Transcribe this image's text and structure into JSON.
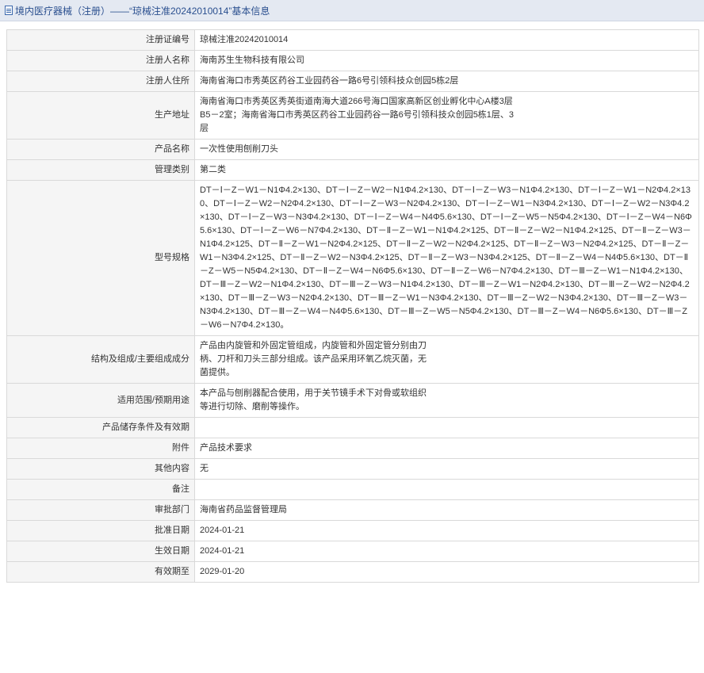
{
  "header": {
    "title": "境内医疗器械（注册）——“琼械注准20242010014”基本信息"
  },
  "rows": [
    {
      "label": "注册证编号",
      "value": "琼械注准20242010014"
    },
    {
      "label": "注册人名称",
      "value": "海南苏生生物科技有限公司"
    },
    {
      "label": "注册人住所",
      "value": "海南省海口市秀英区药谷工业园药谷一路6号引领科技众创园5栋2层"
    },
    {
      "label": "生产地址",
      "value": "海南省海口市秀英区秀英街道南海大道266号海口国家高新区创业孵化中心A楼3层B5－2室；海南省海口市秀英区药谷工业园药谷一路6号引领科技众创园5栋1层、3层"
    },
    {
      "label": "产品名称",
      "value": "一次性使用刨削刀头"
    },
    {
      "label": "管理类别",
      "value": "第二类"
    },
    {
      "label": "型号规格",
      "value": "DT－Ⅰ－Z－W1－N1Φ4.2×130、DT－Ⅰ－Z－W2－N1Φ4.2×130、DT－Ⅰ－Z－W3－N1Φ4.2×130、DT－Ⅰ－Z－W1－N2Φ4.2×130、DT－Ⅰ－Z－W2－N2Φ4.2×130、DT－Ⅰ－Z－W3－N2Φ4.2×130、DT－Ⅰ－Z－W1－N3Φ4.2×130、DT－Ⅰ－Z－W2－N3Φ4.2×130、DT－Ⅰ－Z－W3－N3Φ4.2×130、DT－Ⅰ－Z－W4－N4Φ5.6×130、DT－Ⅰ－Z－W5－N5Φ4.2×130、DT－Ⅰ－Z－W4－N6Φ5.6×130、DT－Ⅰ－Z－W6－N7Φ4.2×130、DT－Ⅱ－Z－W1－N1Φ4.2×125、DT－Ⅱ－Z－W2－N1Φ4.2×125、DT－Ⅱ－Z－W3－N1Φ4.2×125、DT－Ⅱ－Z－W1－N2Φ4.2×125、DT－Ⅱ－Z－W2－N2Φ4.2×125、DT－Ⅱ－Z－W3－N2Φ4.2×125、DT－Ⅱ－Z－W1－N3Φ4.2×125、DT－Ⅱ－Z－W2－N3Φ4.2×125、DT－Ⅱ－Z－W3－N3Φ4.2×125、DT－Ⅱ－Z－W4－N4Φ5.6×130、DT－Ⅱ－Z－W5－N5Φ4.2×130、DT－Ⅱ－Z－W4－N6Φ5.6×130、DT－Ⅱ－Z－W6－N7Φ4.2×130、DT－Ⅲ－Z－W1－N1Φ4.2×130、DT－Ⅲ－Z－W2－N1Φ4.2×130、DT－Ⅲ－Z－W3－N1Φ4.2×130、DT－Ⅲ－Z－W1－N2Φ4.2×130、DT－Ⅲ－Z－W2－N2Φ4.2×130、DT－Ⅲ－Z－W3－N2Φ4.2×130、DT－Ⅲ－Z－W1－N3Φ4.2×130、DT－Ⅲ－Z－W2－N3Φ4.2×130、DT－Ⅲ－Z－W3－N3Φ4.2×130、DT－Ⅲ－Z－W4－N4Φ5.6×130、DT－Ⅲ－Z－W5－N5Φ4.2×130、DT－Ⅲ－Z－W4－N6Φ5.6×130、DT－Ⅲ－Z－W6－N7Φ4.2×130。"
    },
    {
      "label": "结构及组成/主要组成成分",
      "value": "产品由内旋管和外固定管组成，内旋管和外固定管分别由刀柄、刀杆和刀头三部分组成。该产品采用环氧乙烷灭菌，无菌提供。"
    },
    {
      "label": "适用范围/预期用途",
      "value": "本产品与刨削器配合使用，用于关节镜手术下对骨或软组织等进行切除、磨削等操作。"
    },
    {
      "label": "产品储存条件及有效期",
      "value": ""
    },
    {
      "label": "附件",
      "value": "产品技术要求"
    },
    {
      "label": "其他内容",
      "value": "无"
    },
    {
      "label": "备注",
      "value": ""
    },
    {
      "label": "审批部门",
      "value": "海南省药品监督管理局"
    },
    {
      "label": "批准日期",
      "value": "2024-01-21"
    },
    {
      "label": "生效日期",
      "value": "2024-01-21"
    },
    {
      "label": "有效期至",
      "value": "2029-01-20"
    }
  ]
}
